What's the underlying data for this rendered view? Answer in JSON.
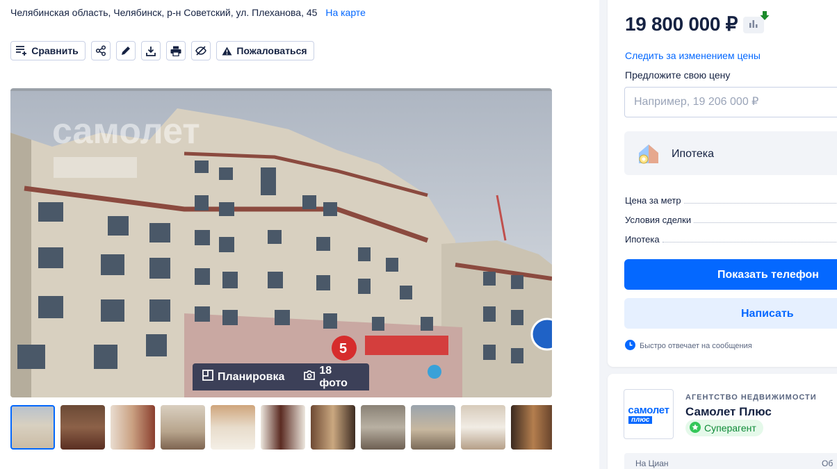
{
  "address": {
    "text": "Челябинская область, Челябинск, р-н Советский, ул. Плеханова, 45",
    "map_link": "На карте"
  },
  "toolbar": {
    "compare_label": "Сравнить",
    "complain_label": "Пожаловаться",
    "icons": [
      "compare-icon",
      "share-icon",
      "pencil-icon",
      "download-icon",
      "print-icon",
      "hide-icon",
      "warning-icon"
    ]
  },
  "gallery": {
    "watermark_text": "самолет",
    "floorplan_label": "Планировка",
    "photos_label": "18 фото",
    "thumbnail_count": 11,
    "active_thumbnail": 1
  },
  "price": {
    "value": "19 800 000 ₽",
    "follow_label": "Следить за изменением цены",
    "offer_label": "Предложите свою цену",
    "offer_placeholder": "Например, 19 206 000 ₽"
  },
  "mortgage": {
    "label": "Ипотека"
  },
  "info_rows": [
    {
      "label": "Цена за метр"
    },
    {
      "label": "Условия сделки"
    },
    {
      "label": "Ипотека"
    }
  ],
  "actions": {
    "phone_label": "Показать телефон",
    "write_label": "Написать",
    "reply_note": "Быстро отвечает на сообщения"
  },
  "agent": {
    "logo_line1": "самолет",
    "logo_line2": "плюс",
    "type": "АГЕНТСТВО НЕДВИЖИМОСТИ",
    "name": "Самолет Плюс",
    "badge": "Суперагент",
    "stats_left": "На Циан",
    "stats_right": "Об"
  },
  "colors": {
    "accent": "#0468ff",
    "text": "#152242",
    "super_badge_bg": "#e5f9ea",
    "super_badge_text": "#0e8a37",
    "price_down_arrow": "#1b8a2a"
  }
}
